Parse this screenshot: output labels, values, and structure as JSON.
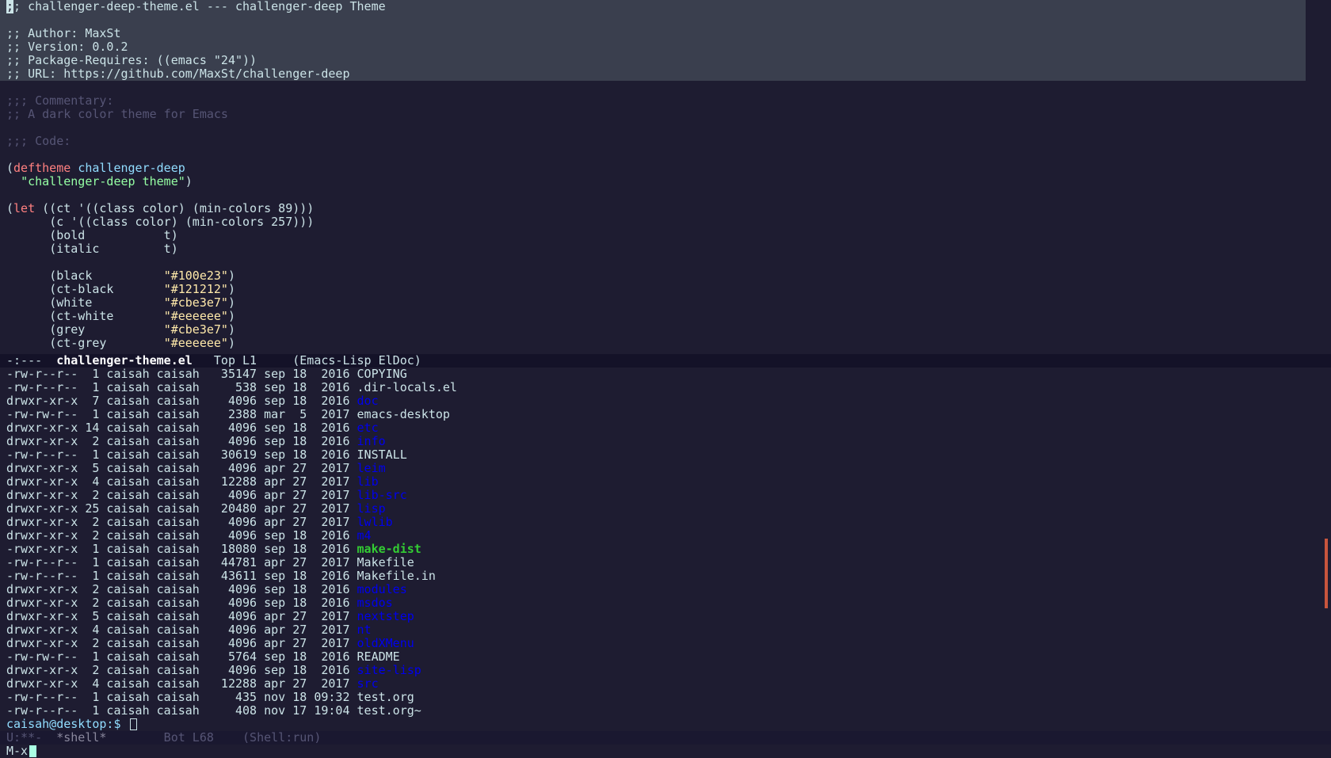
{
  "editor": {
    "header_lines": [
      ";; challenger-deep-theme.el --- challenger-deep Theme",
      "",
      ";; Author: MaxSt",
      ";; Version: 0.0.2",
      ";; Package-Requires: ((emacs \"24\"))",
      ";; URL: https://github.com/MaxSt/challenger-deep"
    ],
    "comment_lines": [
      "",
      ";;; Commentary:",
      ";; A dark color theme for Emacs",
      "",
      ";;; Code:",
      ""
    ],
    "deftheme": {
      "keyword": "deftheme",
      "name": "challenger-deep",
      "docstring": "\"challenger-deep theme\""
    },
    "let_block": {
      "keyword": "let",
      "ct_line": "((ct '((class color) (min-colors 89)))",
      "c_line": "(c '((class color) (min-colors 257)))",
      "bold_line": "(bold           t)",
      "italic_line": "(italic         t)"
    },
    "colors": [
      {
        "name": "(black          ",
        "value": "\"#100e23\""
      },
      {
        "name": "(ct-black       ",
        "value": "\"#121212\""
      },
      {
        "name": "(white          ",
        "value": "\"#cbe3e7\""
      },
      {
        "name": "(ct-white       ",
        "value": "\"#eeeeee\""
      },
      {
        "name": "(grey           ",
        "value": "\"#cbe3e7\""
      },
      {
        "name": "(ct-grey        ",
        "value": "\"#eeeeee\""
      }
    ]
  },
  "modeline_top": {
    "status": "-:---  ",
    "buffer": "challenger-theme.el",
    "position": "   Top L1     ",
    "mode": "(Emacs-Lisp ElDoc)"
  },
  "shell": {
    "listing": [
      {
        "perms": "-rw-r--r--  1 caisah caisah   35147 sep 18  2016 ",
        "name": "COPYING",
        "kind": "file"
      },
      {
        "perms": "-rw-r--r--  1 caisah caisah     538 sep 18  2016 ",
        "name": ".dir-locals.el",
        "kind": "file"
      },
      {
        "perms": "drwxr-xr-x  7 caisah caisah    4096 sep 18  2016 ",
        "name": "doc",
        "kind": "dir"
      },
      {
        "perms": "-rw-rw-r--  1 caisah caisah    2388 mar  5  2017 ",
        "name": "emacs-desktop",
        "kind": "file"
      },
      {
        "perms": "drwxr-xr-x 14 caisah caisah    4096 sep 18  2016 ",
        "name": "etc",
        "kind": "dir"
      },
      {
        "perms": "drwxr-xr-x  2 caisah caisah    4096 sep 18  2016 ",
        "name": "info",
        "kind": "dir"
      },
      {
        "perms": "-rw-r--r--  1 caisah caisah   30619 sep 18  2016 ",
        "name": "INSTALL",
        "kind": "file"
      },
      {
        "perms": "drwxr-xr-x  5 caisah caisah    4096 apr 27  2017 ",
        "name": "leim",
        "kind": "dir"
      },
      {
        "perms": "drwxr-xr-x  4 caisah caisah   12288 apr 27  2017 ",
        "name": "lib",
        "kind": "dir"
      },
      {
        "perms": "drwxr-xr-x  2 caisah caisah    4096 apr 27  2017 ",
        "name": "lib-src",
        "kind": "dir"
      },
      {
        "perms": "drwxr-xr-x 25 caisah caisah   20480 apr 27  2017 ",
        "name": "lisp",
        "kind": "dir"
      },
      {
        "perms": "drwxr-xr-x  2 caisah caisah    4096 apr 27  2017 ",
        "name": "lwlib",
        "kind": "dir"
      },
      {
        "perms": "drwxr-xr-x  2 caisah caisah    4096 sep 18  2016 ",
        "name": "m4",
        "kind": "dir"
      },
      {
        "perms": "-rwxr-xr-x  1 caisah caisah   18080 sep 18  2016 ",
        "name": "make-dist",
        "kind": "exec"
      },
      {
        "perms": "-rw-r--r--  1 caisah caisah   44781 apr 27  2017 ",
        "name": "Makefile",
        "kind": "file"
      },
      {
        "perms": "-rw-r--r--  1 caisah caisah   43611 sep 18  2016 ",
        "name": "Makefile.in",
        "kind": "file"
      },
      {
        "perms": "drwxr-xr-x  2 caisah caisah    4096 sep 18  2016 ",
        "name": "modules",
        "kind": "dir"
      },
      {
        "perms": "drwxr-xr-x  2 caisah caisah    4096 sep 18  2016 ",
        "name": "msdos",
        "kind": "dir"
      },
      {
        "perms": "drwxr-xr-x  5 caisah caisah    4096 apr 27  2017 ",
        "name": "nextstep",
        "kind": "dir"
      },
      {
        "perms": "drwxr-xr-x  4 caisah caisah    4096 apr 27  2017 ",
        "name": "nt",
        "kind": "dir"
      },
      {
        "perms": "drwxr-xr-x  2 caisah caisah    4096 apr 27  2017 ",
        "name": "oldXMenu",
        "kind": "dir"
      },
      {
        "perms": "-rw-rw-r--  1 caisah caisah    5764 sep 18  2016 ",
        "name": "README",
        "kind": "file"
      },
      {
        "perms": "drwxr-xr-x  2 caisah caisah    4096 sep 18  2016 ",
        "name": "site-lisp",
        "kind": "dir"
      },
      {
        "perms": "drwxr-xr-x  4 caisah caisah   12288 apr 27  2017 ",
        "name": "src",
        "kind": "dir"
      },
      {
        "perms": "-rw-r--r--  1 caisah caisah     435 nov 18 09:32 ",
        "name": "test.org",
        "kind": "file"
      },
      {
        "perms": "-rw-r--r--  1 caisah caisah     408 nov 17 19:04 ",
        "name": "test.org~",
        "kind": "file"
      }
    ],
    "prompt": "caisah@desktop:$ "
  },
  "modeline_bottom": {
    "status": "U:**-  ",
    "buffer": "*shell*",
    "position": "        Bot L68    ",
    "mode": "(Shell:run)"
  },
  "minibuffer": {
    "text": "M-x"
  },
  "colors": {
    "background": "#1e1c31",
    "foreground": "#cbe3e7",
    "comment": "#565575",
    "keyword": "#ff8080",
    "function": "#91ddff",
    "string": "#95ffa4",
    "hex": "#ffe9aa",
    "directory": "#0000ee",
    "executable": "#33cc33"
  }
}
